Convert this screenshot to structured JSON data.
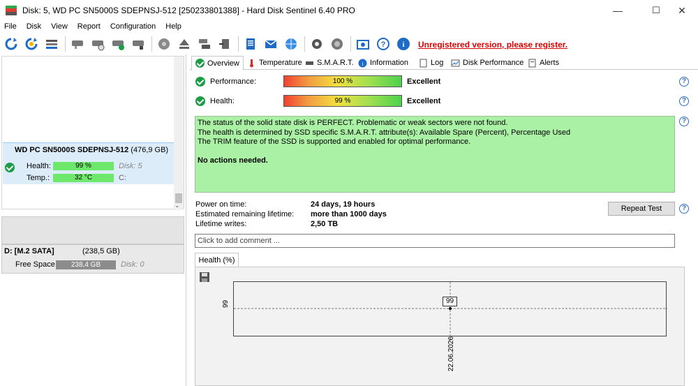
{
  "window": {
    "title": "Disk: 5, WD PC SN5000S SDEPNSJ-512 [250233801388]  -  Hard Disk Sentinel 6.40 PRO",
    "minimize": "—",
    "maximize": "☐",
    "close": "✕"
  },
  "menu": [
    "File",
    "Disk",
    "View",
    "Report",
    "Configuration",
    "Help"
  ],
  "toolbar": {
    "icons": [
      "refresh-icon",
      "refresh-all-icon",
      "disk-list-icon",
      "disk-remove-icon",
      "disk-info-icon",
      "disk-check-icon",
      "disk-status-icon",
      "disk-test-icon",
      "eject-icon",
      "disk-copy-icon",
      "disk-export-icon",
      "report-icon",
      "email-icon",
      "network-icon",
      "settings-icon",
      "audio-icon",
      "screenshot-icon",
      "help-icon",
      "info-icon"
    ],
    "unregistered": "Unregistered version, please register."
  },
  "left": {
    "disk": {
      "name": "WD PC SN5000S SDEPNSJ-512",
      "size": "(476,9 GB)",
      "health_label": "Health:",
      "health_value": "99 %",
      "health_pct": 99,
      "disk_label": "Disk: 5",
      "temp_label": "Temp.:",
      "temp_value": "32 °C",
      "drive_letter": "C:"
    },
    "volume": {
      "name": "D: [M.2 SATA]",
      "size": "(238,5 GB)",
      "free_label": "Free Space",
      "free_value": "238,4 GB",
      "disk_label": "Disk: 0"
    }
  },
  "tabs": [
    {
      "label": "Overview",
      "icon": "check-icon",
      "active": true
    },
    {
      "label": "Temperature",
      "icon": "thermometer-icon"
    },
    {
      "label": "S.M.A.R.T.",
      "icon": "smart-icon"
    },
    {
      "label": "Information",
      "icon": "info-icon"
    },
    {
      "label": "Log",
      "icon": "log-icon"
    },
    {
      "label": "Disk Performance",
      "icon": "performance-icon"
    },
    {
      "label": "Alerts",
      "icon": "alerts-icon"
    }
  ],
  "overview": {
    "performance_label": "Performance:",
    "performance_value": "100 %",
    "performance_pct": 100,
    "performance_rating": "Excellent",
    "health_label": "Health:",
    "health_value": "99 %",
    "health_pct": 99,
    "health_rating": "Excellent",
    "status_lines": [
      "The status of the solid state disk is PERFECT. Problematic or weak sectors were not found.",
      "The health is determined by SSD specific S.M.A.R.T. attribute(s):  Available Spare (Percent), Percentage Used",
      "The TRIM feature of the SSD is supported and enabled for optimal performance."
    ],
    "actions": "No actions needed.",
    "power_on_label": "Power on time:",
    "power_on_value": "24 days, 19 hours",
    "lifetime_label": "Estimated remaining lifetime:",
    "lifetime_value": "more than 1000 days",
    "writes_label": "Lifetime writes:",
    "writes_value": "2,50 TB",
    "repeat_button": "Repeat Test",
    "comment_placeholder": "Click to add comment ..."
  },
  "graph": {
    "tab_label": "Health (%)",
    "y_tick": "99",
    "x_tick": "22.06.2026",
    "point_label": "99"
  }
}
